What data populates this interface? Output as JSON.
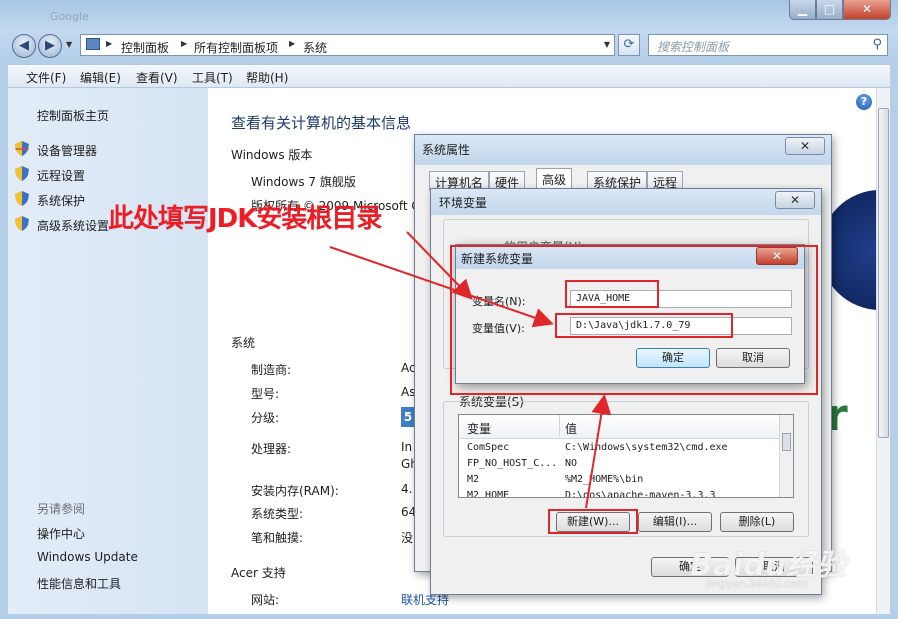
{
  "window": {
    "faded_title": "Google",
    "buttons": {
      "min": "▁",
      "max": "□",
      "close": "✕"
    }
  },
  "address_bar": {
    "crumbs": [
      "控制面板",
      "所有控制面板项",
      "系统"
    ],
    "search_placeholder": "搜索控制面板"
  },
  "menu": [
    "文件(F)",
    "编辑(E)",
    "查看(V)",
    "工具(T)",
    "帮助(H)"
  ],
  "sidebar": {
    "home": "控制面板主页",
    "items": [
      "设备管理器",
      "远程设置",
      "系统保护",
      "高级系统设置"
    ],
    "see_also_title": "另请参阅",
    "see_also": [
      "操作中心",
      "Windows Update",
      "性能信息和工具"
    ]
  },
  "main": {
    "heading": "查看有关计算机的基本信息",
    "edition_section": "Windows 版本",
    "edition": "Windows 7 旗舰版",
    "copyright": "版权所有 © 2009 Microsoft C",
    "system_section": "系统",
    "rows": [
      {
        "label": "制造商:",
        "value": "Ac"
      },
      {
        "label": "型号:",
        "value": "As"
      },
      {
        "label": "分级:",
        "value": "5"
      },
      {
        "label": "处理器:",
        "value": "In"
      },
      {
        "label": "",
        "value": "Gh"
      },
      {
        "label": "安装内存(RAM):",
        "value": "4."
      },
      {
        "label": "系统类型:",
        "value": "64"
      },
      {
        "label": "笔和触摸:",
        "value": "没"
      }
    ],
    "support_section": "Acer 支持",
    "website_label": "网站:",
    "website_link": "联机支持"
  },
  "sys_props": {
    "title": "系统属性",
    "tabs": [
      "计算机名",
      "硬件",
      "高级",
      "系统保护",
      "远程"
    ],
    "active_tab": "高级"
  },
  "env_vars": {
    "title": "环境变量",
    "user_section": "的用户变量(U)",
    "system_section": "系统变量(S)",
    "columns": [
      "变量",
      "值"
    ],
    "rows": [
      {
        "name": "ComSpec",
        "value": "C:\\Windows\\system32\\cmd.exe"
      },
      {
        "name": "FP_NO_HOST_C...",
        "value": "NO"
      },
      {
        "name": "M2",
        "value": "%M2_HOME%\\bin"
      },
      {
        "name": "M2_HOME",
        "value": "D:\\oos\\apache-maven-3.3.3"
      }
    ],
    "buttons": {
      "new": "新建(W)...",
      "edit": "编辑(I)...",
      "delete": "删除(L)"
    },
    "ok": "确定",
    "cancel": "取消"
  },
  "new_var": {
    "title": "新建系统变量",
    "name_label": "变量名(N):",
    "name_value": "JAVA_HOME",
    "value_label": "变量值(V):",
    "value_value": "D:\\Java\\jdk1.7.0_79",
    "ok": "确定",
    "cancel": "取消"
  },
  "annotation": {
    "text": "此处填写JDK安装根目录",
    "color": "#ec1d24"
  },
  "watermark": {
    "brand": "Baidu经验",
    "url": "jingyan.baidu.com"
  },
  "oem_glyph": "r"
}
